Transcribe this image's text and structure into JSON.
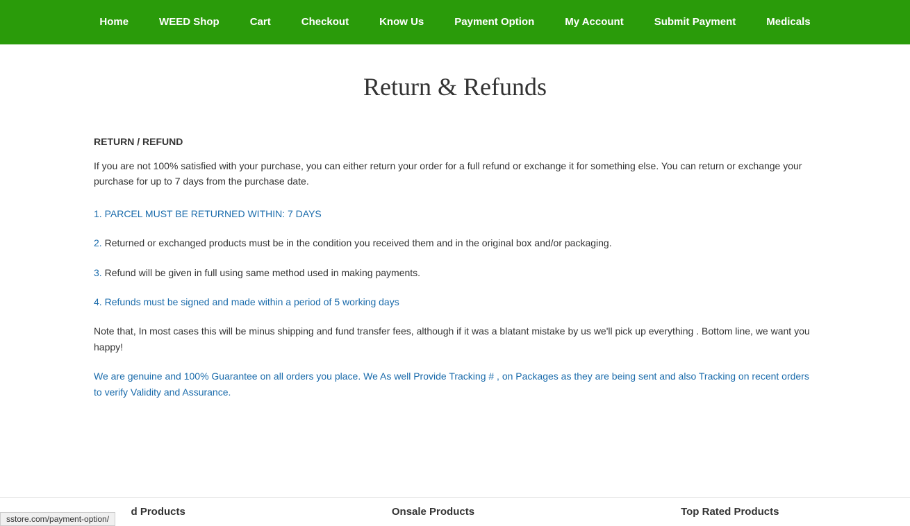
{
  "nav": {
    "items": [
      {
        "label": "Home",
        "href": "#"
      },
      {
        "label": "WEED Shop",
        "href": "#"
      },
      {
        "label": "Cart",
        "href": "#"
      },
      {
        "label": "Checkout",
        "href": "#"
      },
      {
        "label": "Know Us",
        "href": "#"
      },
      {
        "label": "Payment Option",
        "href": "#"
      },
      {
        "label": "My Account",
        "href": "#"
      },
      {
        "label": "Submit Payment",
        "href": "#"
      },
      {
        "label": "Medicals",
        "href": "#"
      }
    ]
  },
  "page": {
    "title": "Return & Refunds",
    "section_heading": "RETURN / REFUND",
    "intro": "If you are not 100% satisfied with your purchase, you can either return your order for a full refund or exchange it for something else. You can return or exchange your purchase for up to 7 days from the purchase date.",
    "list_items": [
      {
        "number": "1.",
        "text": " PARCEL MUST BE RETURNED WITHIN: 7 DAYS",
        "blue": true
      },
      {
        "number": "2.",
        "text": " Returned or exchanged products must be in the condition you received them and in the original box and/or packaging.",
        "blue": false
      },
      {
        "number": "3.",
        "text": " Refund will be given in full using same method used in making payments.",
        "blue": false
      },
      {
        "number": "4.",
        "text": " Refunds must be signed and made within a period of 5 working days",
        "blue": true
      }
    ],
    "note": "Note that, In most cases this will be minus shipping and fund transfer fees, although if it was a blatant mistake by us we'll pick up everything . Bottom line, we want you happy!",
    "guarantee": "We are genuine and 100% Guarantee on all orders you place. We As well Provide Tracking # , on Packages as they are being sent and also Tracking on recent orders to verify Validity and Assurance."
  },
  "footer": {
    "col1": "d Products",
    "col2": "Onsale Products",
    "col3": "Top Rated Products"
  },
  "statusbar": {
    "url": "sstore.com/payment-option/"
  }
}
